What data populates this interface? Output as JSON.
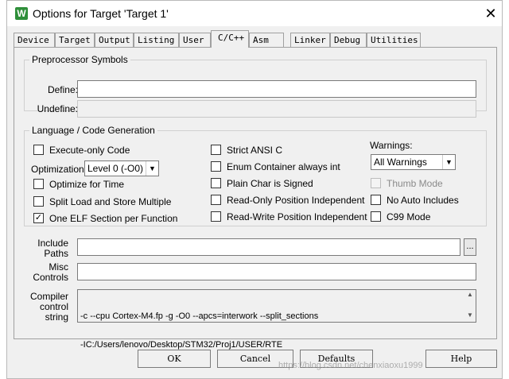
{
  "window": {
    "title": "Options for Target 'Target 1'",
    "icon_letter": "W",
    "close_glyph": "✕"
  },
  "tabs": [
    {
      "label": "Device"
    },
    {
      "label": "Target"
    },
    {
      "label": "Output"
    },
    {
      "label": "Listing"
    },
    {
      "label": "User"
    },
    {
      "label": "C/C++",
      "active": true
    },
    {
      "label": "Asm"
    },
    {
      "label": "Linker"
    },
    {
      "label": "Debug"
    },
    {
      "label": "Utilities"
    }
  ],
  "preprocessor": {
    "legend": "Preprocessor Symbols",
    "define_label": "Define:",
    "define_value": "",
    "undefine_label": "Undefine:",
    "undefine_value": ""
  },
  "codegen": {
    "legend": "Language / Code Generation",
    "execute_only": {
      "label": "Execute-only Code",
      "checked": false
    },
    "optimization_label": "Optimization:",
    "optimization_value": "Level 0 (-O0)",
    "optimize_time": {
      "label": "Optimize for Time",
      "checked": false
    },
    "split_load": {
      "label": "Split Load and Store Multiple",
      "checked": false
    },
    "one_elf": {
      "label": "One ELF Section per Function",
      "checked": true
    },
    "strict_ansi": {
      "label": "Strict ANSI C",
      "checked": false
    },
    "enum_container": {
      "label": "Enum Container always int",
      "checked": false
    },
    "plain_char": {
      "label": "Plain Char is Signed",
      "checked": false
    },
    "ro_pi": {
      "label": "Read-Only Position Independent",
      "checked": false
    },
    "rw_pi": {
      "label": "Read-Write Position Independent",
      "checked": false
    },
    "warnings_label": "Warnings:",
    "warnings_value": "All Warnings",
    "thumb_mode": {
      "label": "Thumb Mode",
      "checked": false,
      "disabled": true
    },
    "no_auto_includes": {
      "label": "No Auto Includes",
      "checked": false
    },
    "c99_mode": {
      "label": "C99 Mode",
      "checked": false
    }
  },
  "include_paths": {
    "label_line1": "Include",
    "label_line2": "Paths",
    "value": "",
    "browse": "..."
  },
  "misc_controls": {
    "label_line1": "Misc",
    "label_line2": "Controls",
    "value": ""
  },
  "compiler_control": {
    "label_line1": "Compiler",
    "label_line2": "control",
    "label_line3": "string",
    "line1": "-c --cpu Cortex-M4.fp -g -O0 --apcs=interwork --split_sections",
    "line2": "-IC:/Users/lenovo/Desktop/STM32/Proj1/USER/RTE"
  },
  "buttons": {
    "ok": "OK",
    "cancel": "Cancel",
    "defaults": "Defaults",
    "help": "Help"
  },
  "watermark": "https://blog.csdn.net/chenxiaoxu1999"
}
